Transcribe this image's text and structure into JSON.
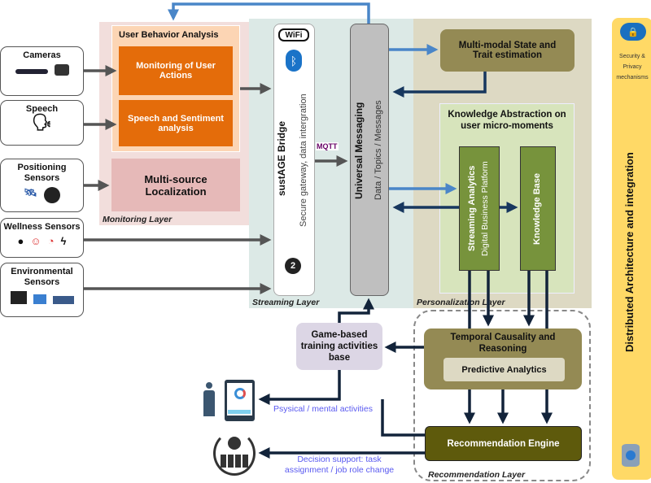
{
  "sensors": [
    {
      "label": "Cameras",
      "icons": [
        "depth-camera",
        "industrial-camera"
      ]
    },
    {
      "label": "Speech",
      "icons": [
        "speaking-head"
      ]
    },
    {
      "label": "Positioning Sensors",
      "icons": [
        "satellite",
        "beacon"
      ]
    },
    {
      "label": "Wellness Sensors",
      "icons": [
        "wristband",
        "face",
        "gauge",
        "lightning"
      ]
    },
    {
      "label": "Environmental Sensors",
      "icons": [
        "board",
        "sensor-module",
        "sensor-board"
      ]
    }
  ],
  "monitoring": {
    "layer_label": "Monitoring Layer",
    "uba_title": "User Behavior Analysis",
    "actions": "Monitoring of User Actions",
    "speech": "Speech and Sentiment analysis",
    "localization": "Multi-source Localization"
  },
  "streaming": {
    "layer_label": "Streaming Layer",
    "bridge_title": "sustAGE Bridge",
    "bridge_sub": "Secure gateway, data intergration",
    "wifi": "WiFi",
    "mqtt": "MQTT",
    "um_title": "Universal Messaging",
    "um_sub": "Data / Topics / Messages"
  },
  "personalization": {
    "layer_label": "Personalization Layer",
    "multimodal": "Multi-modal State and Trait estimation",
    "ka_title": "Knowledge Abstraction on user micro-moments",
    "sa_title": "Streaming Analytics",
    "sa_sub": "Digital Business Platform",
    "kb": "Knowledge Base"
  },
  "recommendation": {
    "layer_label": "Recommendation Layer",
    "temporal": "Temporal Causality and Reasoning",
    "predictive": "Predictive Analytics",
    "engine": "Recommendation Engine"
  },
  "game": "Game-based training activities base",
  "outputs": {
    "physical": "Psysical / mental activities",
    "decision": "Decision support: task assignment / job role change"
  },
  "side": {
    "title": "Distributed Architecture and integration",
    "security": "Security & Privacy mechanisms"
  },
  "colors": {
    "orange": "#e46c0a",
    "olive": "#948a54",
    "green": "#77933c",
    "dark_olive": "#5e5a0c",
    "blue_arrow": "#4a86c8",
    "dark_arrow": "#17375e",
    "yellow": "#ffd966"
  }
}
